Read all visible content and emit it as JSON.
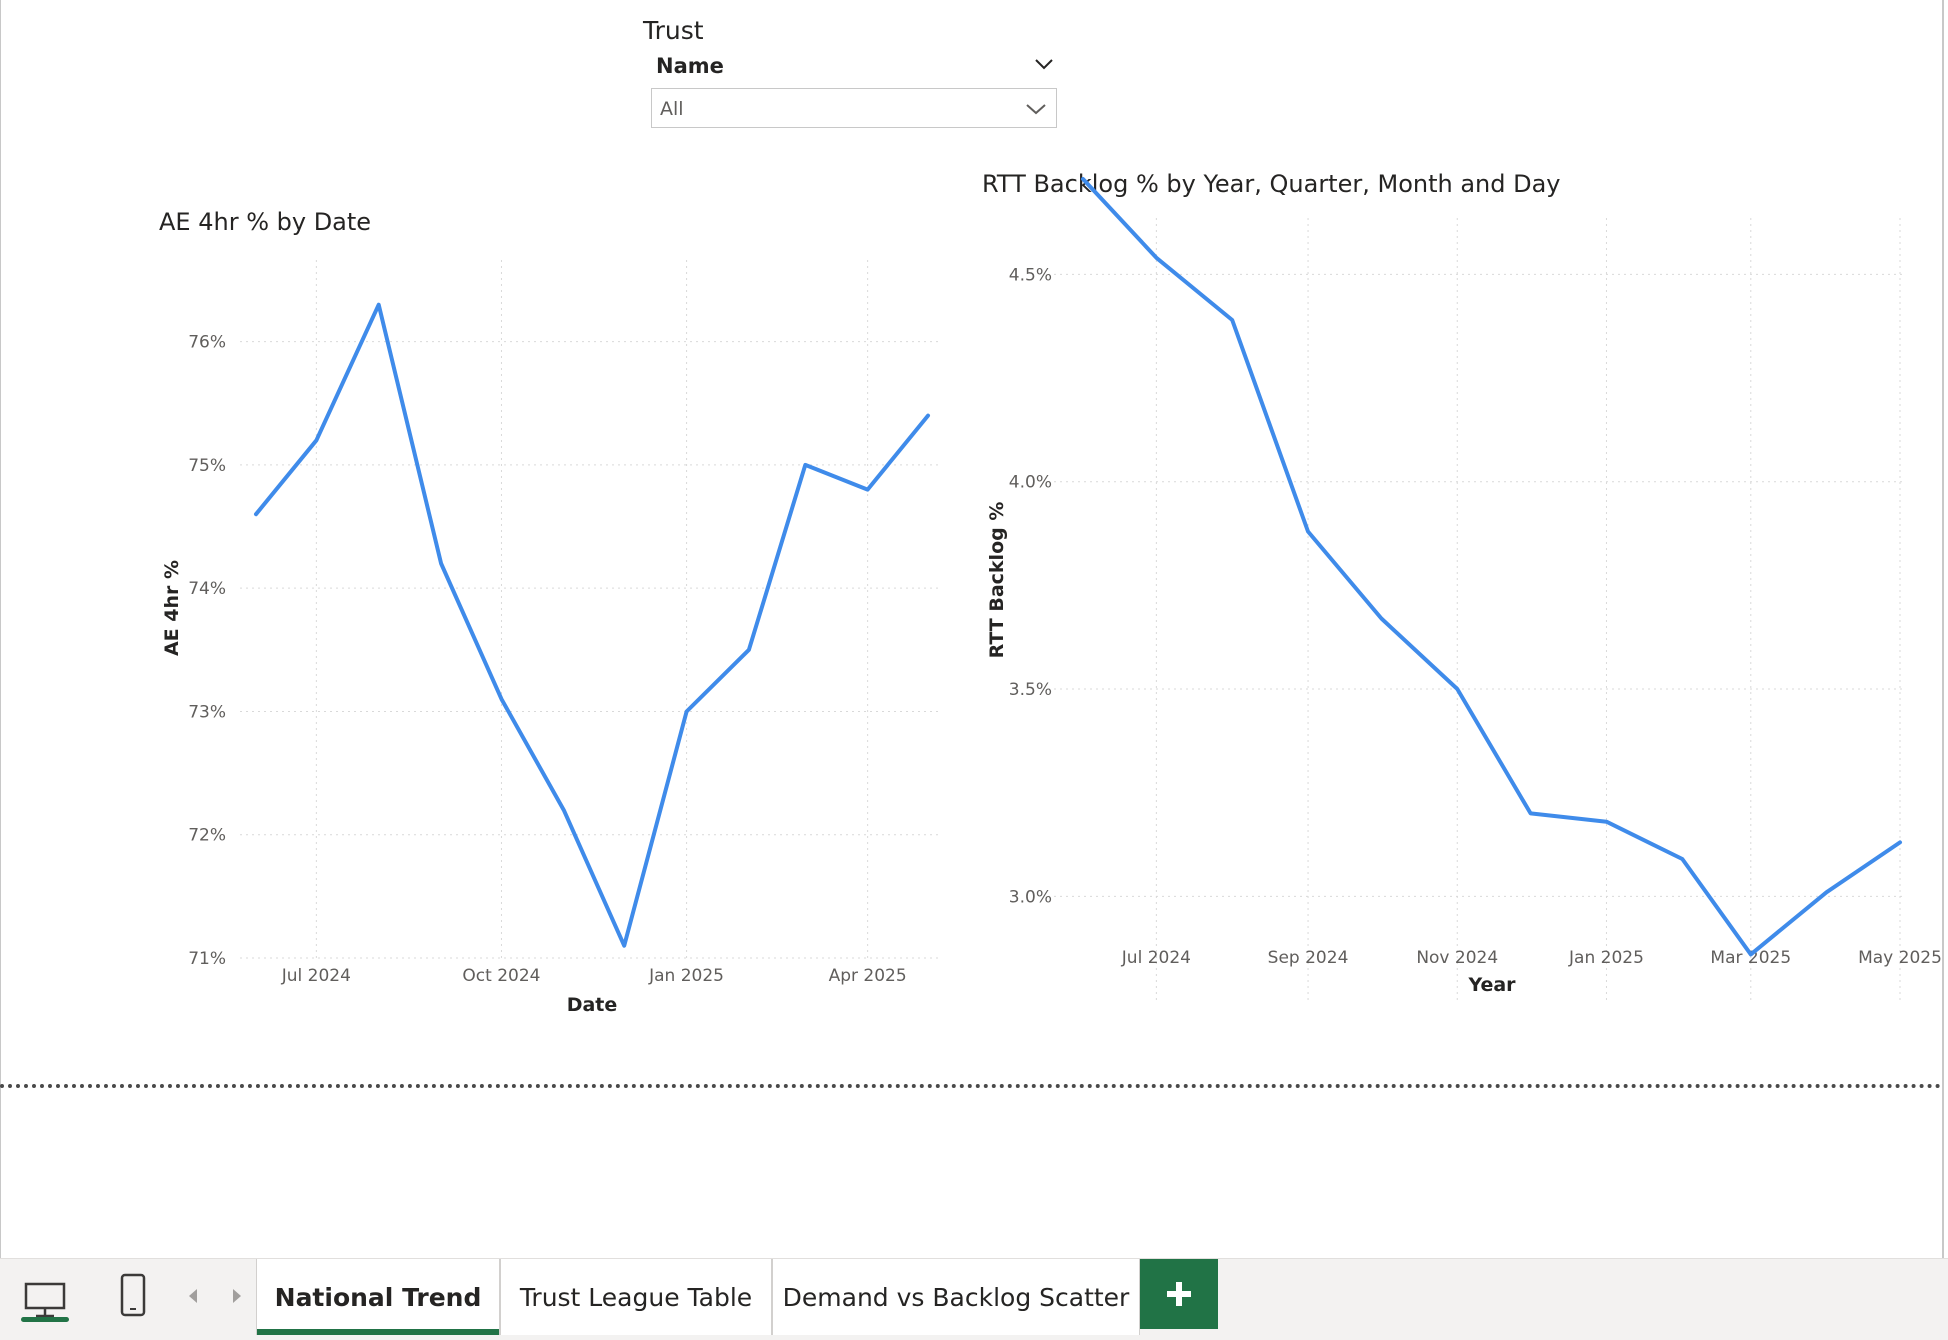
{
  "slicer": {
    "title": "Trust",
    "field": "Name",
    "selected": "All"
  },
  "colors": {
    "line": "#3f8bea",
    "accent": "#217346",
    "grid": "#d9d9d9"
  },
  "charts": {
    "ae": {
      "title": "AE 4hr % by Date"
    },
    "rtt": {
      "title": "RTT Backlog % by Year, Quarter, Month and Day"
    }
  },
  "chart_data": [
    {
      "type": "line",
      "title": "AE 4hr % by Date",
      "xlabel": "Date",
      "ylabel": "AE 4hr %",
      "x": [
        "2024-06-01",
        "2024-07-01",
        "2024-08-01",
        "2024-09-01",
        "2024-10-01",
        "2024-11-01",
        "2024-12-01",
        "2025-01-01",
        "2025-02-01",
        "2025-03-01",
        "2025-04-01",
        "2025-05-01"
      ],
      "series": [
        {
          "values": [
            74.6,
            75.2,
            76.3,
            74.2,
            73.1,
            72.2,
            71.1,
            73.0,
            73.5,
            75.0,
            74.8,
            75.4
          ]
        }
      ],
      "ylim": [
        71,
        76.5
      ],
      "yticks": [
        "71%",
        "72%",
        "73%",
        "74%",
        "75%",
        "76%"
      ],
      "xticks": [
        "Jul 2024",
        "Oct 2024",
        "Jan 2025",
        "Apr 2025"
      ],
      "grid": true
    },
    {
      "type": "line",
      "title": "RTT Backlog % by Year, Quarter, Month and Day",
      "xlabel": "Year",
      "ylabel": "RTT Backlog %",
      "x": [
        "2024-06-01",
        "2024-07-01",
        "2024-08-01",
        "2024-09-01",
        "2024-10-01",
        "2024-11-01",
        "2024-12-01",
        "2025-01-01",
        "2025-02-01",
        "2025-03-01",
        "2025-04-01",
        "2025-05-01"
      ],
      "series": [
        {
          "values": [
            4.73,
            4.54,
            4.39,
            3.88,
            3.67,
            3.5,
            3.2,
            3.18,
            3.09,
            2.86,
            3.01,
            3.13
          ]
        }
      ],
      "ylim": [
        2.75,
        4.8
      ],
      "yticks": [
        "3.0%",
        "3.5%",
        "4.0%",
        "4.5%"
      ],
      "xticks": [
        "Jul 2024",
        "Sep 2024",
        "Nov 2024",
        "Jan 2025",
        "Mar 2025",
        "May 2025"
      ],
      "grid": true
    }
  ],
  "pages": {
    "tabs": [
      {
        "label": "National Trend",
        "active": true
      },
      {
        "label": "Trust League Table",
        "active": false
      },
      {
        "label": "Demand vs Backlog Scatter",
        "active": false
      }
    ],
    "add_icon": "plus-icon",
    "view_icons": [
      "desktop-icon",
      "phone-icon",
      "chevron-left-icon",
      "chevron-right-icon"
    ]
  }
}
